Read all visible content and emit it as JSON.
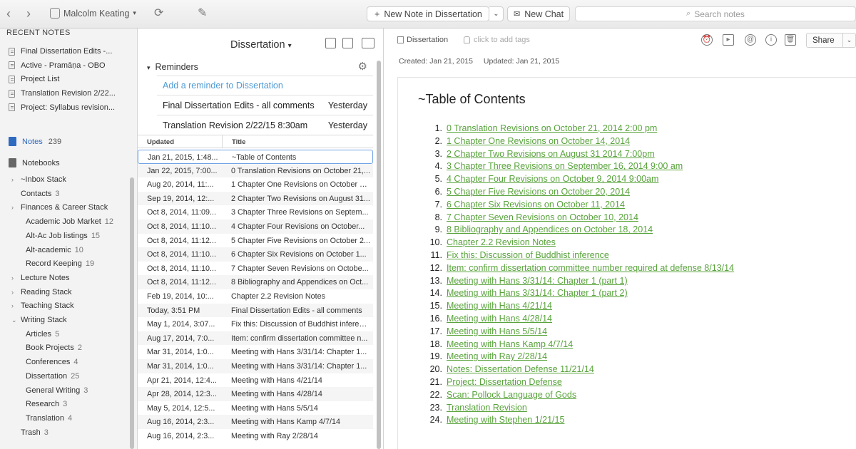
{
  "toolbar": {
    "user": "Malcolm Keating",
    "new_note": "New Note in Dissertation",
    "new_chat": "New Chat",
    "search_placeholder": "Search notes"
  },
  "sidebar": {
    "recent_heading": "RECENT NOTES",
    "recent": [
      "Final Dissertation Edits -...",
      "Active - Pramāṇa - OBO",
      "Project List",
      "Translation Revision 2/22...",
      "Project: Syllabus revision..."
    ],
    "notes_label": "Notes",
    "notes_count": "239",
    "notebooks_label": "Notebooks",
    "tree": [
      {
        "label": "~Inbox Stack",
        "count": "",
        "arrow": "›",
        "indent": 1
      },
      {
        "label": "Contacts",
        "count": "3",
        "arrow": "",
        "indent": 1
      },
      {
        "label": "Finances & Career Stack",
        "count": "",
        "arrow": "›",
        "indent": 1
      },
      {
        "label": "Academic Job Market",
        "count": "12",
        "arrow": "",
        "indent": 2
      },
      {
        "label": "Alt-Ac Job listings",
        "count": "15",
        "arrow": "",
        "indent": 2
      },
      {
        "label": "Alt-academic",
        "count": "10",
        "arrow": "",
        "indent": 2
      },
      {
        "label": "Record Keeping",
        "count": "19",
        "arrow": "",
        "indent": 2
      },
      {
        "label": "Lecture Notes",
        "count": "",
        "arrow": "›",
        "indent": 1
      },
      {
        "label": "Reading Stack",
        "count": "",
        "arrow": "›",
        "indent": 1
      },
      {
        "label": "Teaching Stack",
        "count": "",
        "arrow": "›",
        "indent": 1
      },
      {
        "label": "Writing Stack",
        "count": "",
        "arrow": "⌄",
        "indent": 1
      },
      {
        "label": "Articles",
        "count": "5",
        "arrow": "",
        "indent": 2
      },
      {
        "label": "Book Projects",
        "count": "2",
        "arrow": "",
        "indent": 2
      },
      {
        "label": "Conferences",
        "count": "4",
        "arrow": "",
        "indent": 2
      },
      {
        "label": "Dissertation",
        "count": "25",
        "arrow": "",
        "indent": 2
      },
      {
        "label": "General Writing",
        "count": "3",
        "arrow": "",
        "indent": 2
      },
      {
        "label": "Research",
        "count": "3",
        "arrow": "",
        "indent": 2
      },
      {
        "label": "Translation",
        "count": "4",
        "arrow": "",
        "indent": 2
      },
      {
        "label": "Trash",
        "count": "3",
        "arrow": "",
        "indent": 1
      }
    ]
  },
  "notelist": {
    "title": "Dissertation",
    "reminders_label": "Reminders",
    "add_reminder": "Add a reminder to Dissertation",
    "reminders": [
      {
        "title": "Final Dissertation Edits - all comments",
        "date": "Yesterday"
      },
      {
        "title": "Translation Revision 2/22/15 8:30am",
        "date": "Yesterday"
      }
    ],
    "col_updated": "Updated",
    "col_title": "Title",
    "rows": [
      {
        "updated": "Jan 21, 2015, 1:48...",
        "title": "~Table of Contents"
      },
      {
        "updated": "Jan 22, 2015, 7:00...",
        "title": "0 Translation Revisions on October 21,..."
      },
      {
        "updated": "Aug 20, 2014, 11:...",
        "title": "1 Chapter One Revisions on October 14..."
      },
      {
        "updated": "Sep 19, 2014, 12:...",
        "title": "2 Chapter Two Revisions on August 31..."
      },
      {
        "updated": "Oct 8, 2014, 11:09...",
        "title": "3 Chapter Three Revisions on Septem..."
      },
      {
        "updated": "Oct 8, 2014, 11:10...",
        "title": "4 Chapter Four Revisions on October..."
      },
      {
        "updated": "Oct 8, 2014, 11:12...",
        "title": "5 Chapter Five Revisions on October 2..."
      },
      {
        "updated": "Oct 8, 2014, 11:10...",
        "title": "6 Chapter Six Revisions on October 1..."
      },
      {
        "updated": "Oct 8, 2014, 11:10...",
        "title": "7 Chapter Seven Revisions on Octobe..."
      },
      {
        "updated": "Oct 8, 2014, 11:12...",
        "title": "8 Bibliography and Appendices on Oct..."
      },
      {
        "updated": "Feb 19, 2014, 10:...",
        "title": "Chapter 2.2 Revision Notes"
      },
      {
        "updated": "Today, 3:51 PM",
        "title": "Final Dissertation Edits - all comments"
      },
      {
        "updated": "May 1, 2014, 3:07...",
        "title": "Fix this: Discussion of Buddhist inference"
      },
      {
        "updated": "Aug 17, 2014, 7:0...",
        "title": "Item: confirm dissertation committee n..."
      },
      {
        "updated": "Mar 31, 2014, 1:0...",
        "title": "Meeting with Hans 3/31/14: Chapter 1..."
      },
      {
        "updated": "Mar 31, 2014, 1:0...",
        "title": "Meeting with Hans 3/31/14: Chapter 1..."
      },
      {
        "updated": "Apr 21, 2014, 12:4...",
        "title": "Meeting with Hans 4/21/14"
      },
      {
        "updated": "Apr 28, 2014, 12:3...",
        "title": "Meeting with Hans 4/28/14"
      },
      {
        "updated": "May 5, 2014, 12:5...",
        "title": "Meeting with Hans 5/5/14"
      },
      {
        "updated": "Aug 16, 2014, 2:3...",
        "title": "Meeting with Hans Kamp 4/7/14"
      },
      {
        "updated": "Aug 16, 2014, 2:3...",
        "title": "Meeting with Ray 2/28/14"
      }
    ]
  },
  "editor": {
    "notebook": "Dissertation",
    "tags_placeholder": "click to add tags",
    "share": "Share",
    "created": "Created: Jan 21, 2015",
    "updated": "Updated: Jan 21, 2015",
    "doc_title": "~Table of Contents",
    "toc": [
      "0 Translation Revisions on October 21, 2014 2:00 pm",
      "1 Chapter One Revisions on October 14, 2014",
      "2 Chapter Two Revisions on August 31 2014 7:00pm",
      "3 Chapter Three Revisions on September 16, 2014 9:00 am",
      "4 Chapter Four Revisions on October 9, 2014 9:00am",
      "5 Chapter Five Revisions on October 20, 2014",
      "6 Chapter Six Revisions on October 11, 2014",
      "7 Chapter Seven Revisions on October 10, 2014",
      "8 Bibliography and Appendices on October 18, 2014",
      "Chapter 2.2 Revision Notes",
      "Fix this: Discussion of Buddhist inference",
      "Item: confirm dissertation committee number required at defense 8/13/14",
      "Meeting with Hans 3/31/14: Chapter 1 (part 1)",
      "Meeting with Hans 3/31/14: Chapter 1 (part 2)",
      "Meeting with Hans 4/21/14",
      "Meeting with Hans 4/28/14",
      "Meeting with Hans 5/5/14",
      "Meeting with Hans Kamp 4/7/14",
      "Meeting with Ray 2/28/14",
      "Notes: Dissertation Defense 11/21/14",
      "Project: Dissertation Defense",
      "Scan: Pollock Language of Gods",
      "Translation Revision",
      "Meeting with Stephen 1/21/15"
    ]
  },
  "colors": {
    "accent_blue": "#2f6ac1",
    "link_green": "#58a33b",
    "reminder_blue": "#4e9ad6"
  }
}
